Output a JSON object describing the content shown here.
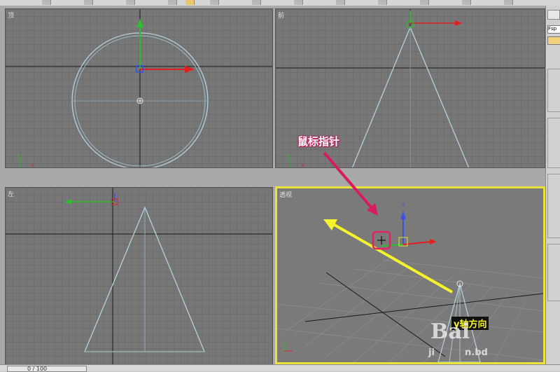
{
  "viewports": {
    "top": {
      "label": "顶"
    },
    "front": {
      "label": "前"
    },
    "left": {
      "label": "左"
    },
    "perspective": {
      "label": "透视"
    }
  },
  "annotations": {
    "mouse_pointer": "鼠标指针",
    "y_axis_direction": "y轴方向"
  },
  "axis_labels": {
    "x": "x",
    "y": "y",
    "z": "z"
  },
  "timeline": {
    "frame": "0 / 100"
  },
  "right_panel": {
    "field": "Fsp"
  },
  "watermark": {
    "big": "Bai",
    "sub_left": "ji",
    "sub_right": "n.bd"
  },
  "colors": {
    "active_border": "#e8e23a",
    "callout_arrow": "#d81b60",
    "y_arrow": "#f4f42a"
  }
}
